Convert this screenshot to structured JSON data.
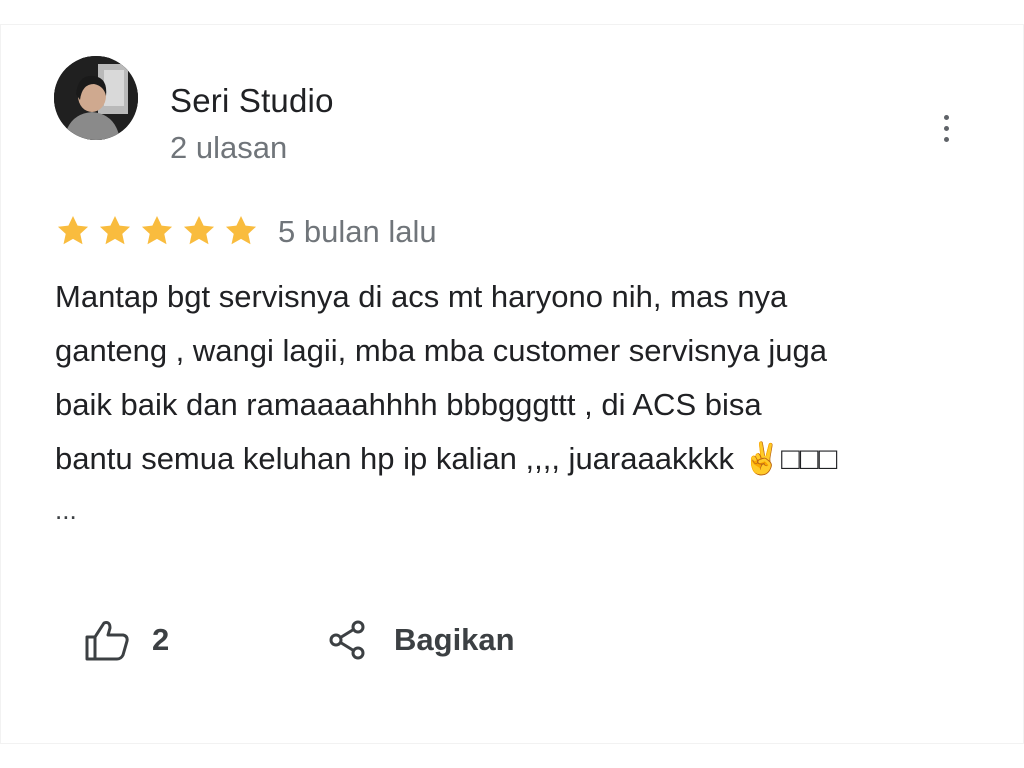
{
  "reviewer": {
    "name": "Seri Studio",
    "review_count": "2 ulasan"
  },
  "rating": {
    "stars": 5,
    "max": 5,
    "color": "#F9BC3E",
    "date": "5 bulan lalu"
  },
  "review": {
    "text": "Mantap bgt servisnya di acs mt haryono nih, mas nya\nganteng , wangi lagii, mba mba customer servisnya juga\nbaik baik dan ramaaaahhhh bbbgggttt , di ACS bisa\nbantu semua keluhan hp ip kalian ,,,, juaraaakkkk ✌️□□□",
    "more": "..."
  },
  "actions": {
    "like_count": "2",
    "share_label": "Bagikan"
  },
  "icons": {
    "menu": "more-vert-icon",
    "like": "thumbs-up-icon",
    "share": "share-icon",
    "star": "star-icon"
  }
}
